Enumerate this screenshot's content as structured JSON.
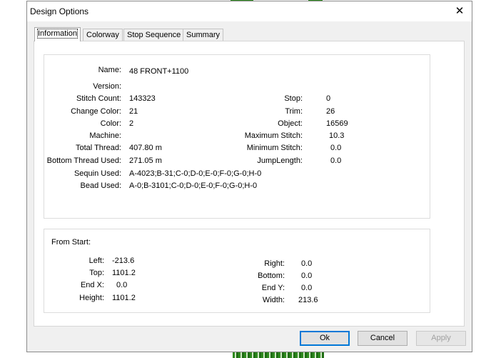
{
  "window": {
    "title": "Design Options",
    "close_glyph": "✕"
  },
  "tabs": [
    {
      "label": "Information",
      "active": true
    },
    {
      "label": "Colorway"
    },
    {
      "label": "Stop Sequence"
    },
    {
      "label": "Summary"
    }
  ],
  "info": {
    "name": {
      "label": "Name:",
      "value": "48 FRONT+1100"
    },
    "version": {
      "label": "Version:",
      "value": ""
    },
    "stitch_count": {
      "label": "Stitch Count:",
      "value": "143323"
    },
    "change_color": {
      "label": "Change Color:",
      "value": "21"
    },
    "color": {
      "label": "Color:",
      "value": "2"
    },
    "machine": {
      "label": "Machine:",
      "value": ""
    },
    "total_thread": {
      "label": "Total Thread:",
      "value": "407.80 m"
    },
    "bottom_thread": {
      "label": "Bottom Thread Used:",
      "value": "271.05 m"
    },
    "sequin_used": {
      "label": "Sequin Used:",
      "value": "A-4023;B-31;C-0;D-0;E-0;F-0;G-0;H-0"
    },
    "bead_used": {
      "label": "Bead Used:",
      "value": "A-0;B-3101;C-0;D-0;E-0;F-0;G-0;H-0"
    },
    "stop": {
      "label": "Stop:",
      "value": "0"
    },
    "trim": {
      "label": "Trim:",
      "value": "26"
    },
    "object": {
      "label": "Object:",
      "value": "16569"
    },
    "max_stitch": {
      "label": "Maximum Stitch:",
      "value": "10.3"
    },
    "min_stitch": {
      "label": "Minimum Stitch:",
      "value": "0.0"
    },
    "jump_length": {
      "label": "JumpLength:",
      "value": "0.0"
    }
  },
  "from_start": {
    "caption": "From Start:",
    "left": {
      "label": "Left:",
      "value": "-213.6"
    },
    "top": {
      "label": "Top:",
      "value": "1101.2"
    },
    "end_x": {
      "label": "End X:",
      "value": "0.0"
    },
    "height": {
      "label": "Height:",
      "value": "1101.2"
    },
    "right": {
      "label": "Right:",
      "value": "0.0"
    },
    "bottom": {
      "label": "Bottom:",
      "value": "0.0"
    },
    "end_y": {
      "label": "End Y:",
      "value": "0.0"
    },
    "width": {
      "label": "Width:",
      "value": "213.6"
    }
  },
  "buttons": {
    "ok": "Ok",
    "cancel": "Cancel",
    "apply": "Apply"
  }
}
